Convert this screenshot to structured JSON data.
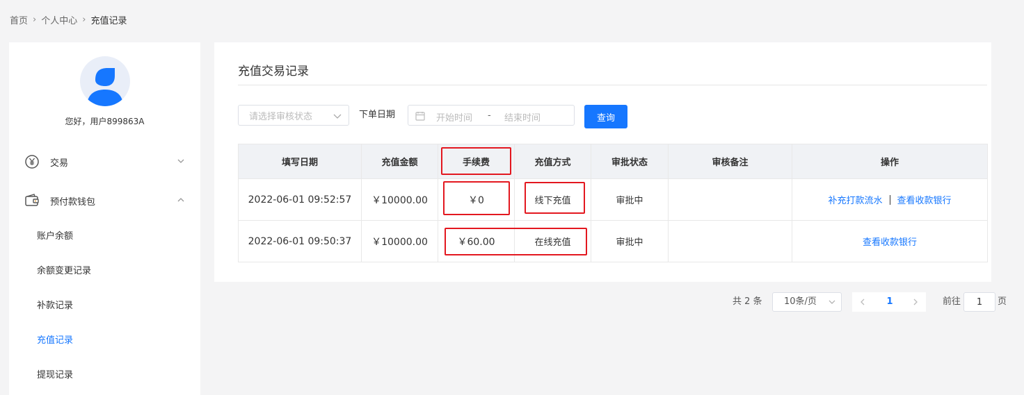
{
  "breadcrumb": [
    "首页",
    "个人中心",
    "充值记录"
  ],
  "user": {
    "greeting": "您好，用户899863A"
  },
  "sidebar": {
    "groups": [
      {
        "label": "交易",
        "icon": "yen-circle-icon",
        "expanded": false
      },
      {
        "label": "预付款钱包",
        "icon": "wallet-icon",
        "expanded": true
      }
    ],
    "sub_items": [
      "账户余额",
      "余额变更记录",
      "补款记录",
      "充值记录",
      "提现记录"
    ],
    "active_item": "充值记录"
  },
  "panel": {
    "title": "充值交易记录"
  },
  "filters": {
    "status_placeholder": "请选择审核状态",
    "date_label": "下单日期",
    "start_placeholder": "开始时间",
    "range_separator": "-",
    "end_placeholder": "结束时间",
    "query_label": "查询"
  },
  "table": {
    "headers": [
      "填写日期",
      "充值金额",
      "手续费",
      "充值方式",
      "审批状态",
      "审核备注",
      "操作"
    ],
    "rows": [
      {
        "date": "2022-06-01 09:52:57",
        "amount": "￥10000.00",
        "fee": "￥0",
        "method": "线下充值",
        "status": "审批中",
        "remark": "",
        "actions": [
          "补充打款流水",
          "查看收款银行"
        ]
      },
      {
        "date": "2022-06-01 09:50:37",
        "amount": "￥10000.00",
        "fee": "￥60.00",
        "method": "在线充值",
        "status": "审批中",
        "remark": "",
        "actions": [
          "查看收款银行"
        ]
      }
    ]
  },
  "pagination": {
    "total": "共 2 条",
    "page_size": "10条/页",
    "current_page": "1",
    "goto_label": "前往",
    "goto_value": "1",
    "goto_suffix": "页"
  },
  "colors": {
    "primary": "#1677ff",
    "highlight": "#e3171f",
    "header_bg": "#f0f2f5"
  }
}
